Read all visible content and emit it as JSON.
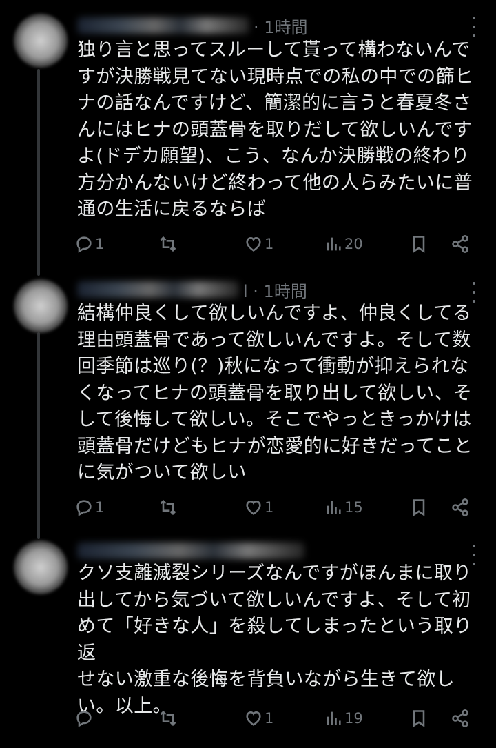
{
  "colors": {
    "background": "#000000",
    "text": "#e7e9ea",
    "muted": "#71767b",
    "thread_line": "#333639"
  },
  "icons": [
    "reply-icon",
    "retweet-icon",
    "like-icon",
    "views-icon",
    "bookmark-icon",
    "share-icon",
    "more-icon"
  ],
  "tweets": [
    {
      "time": "· 1時間",
      "lines": [
        "独り言と思ってスルーして貰って構わないんで",
        "すが決勝戦見てない現時点での私の中での篩ヒ",
        "ナの話なんですけど、簡潔的に言うと春夏冬さ",
        "んにはヒナの頭蓋骨を取りだして欲しいんです",
        "よ(ドデカ願望)、こう、なんか決勝戦の終わり",
        "方分かんないけど終わって他の人らみたいに普",
        "通の生活に戻るならば"
      ],
      "replies": "1",
      "retweets": "",
      "likes": "1",
      "views": "20"
    },
    {
      "time": "l · 1時間",
      "lines": [
        "結構仲良くして欲しいんですよ、仲良くしてる",
        "理由頭蓋骨であって欲しいんですよ。そして数",
        "回季節は巡り(？)秋になって衝動が抑えられな",
        "くなってヒナの頭蓋骨を取り出して欲しい、そ",
        "して後悔して欲しい。そこでやっときっかけは",
        "頭蓋骨だけどもヒナが恋愛的に好きだってこと",
        "に気がついて欲しい"
      ],
      "replies": "1",
      "retweets": "",
      "likes": "1",
      "views": "15"
    },
    {
      "time": "",
      "lines": [
        "クソ支離滅裂シリーズなんですがほんまに取り",
        "出してから気づいて欲しいんですよ、そして初",
        "めて「好きな人」を殺してしまったという取り返",
        "せない激重な後悔を背負いながら生きて欲し",
        "い。以上。"
      ],
      "replies": "",
      "retweets": "",
      "likes": "1",
      "views": "19"
    }
  ]
}
